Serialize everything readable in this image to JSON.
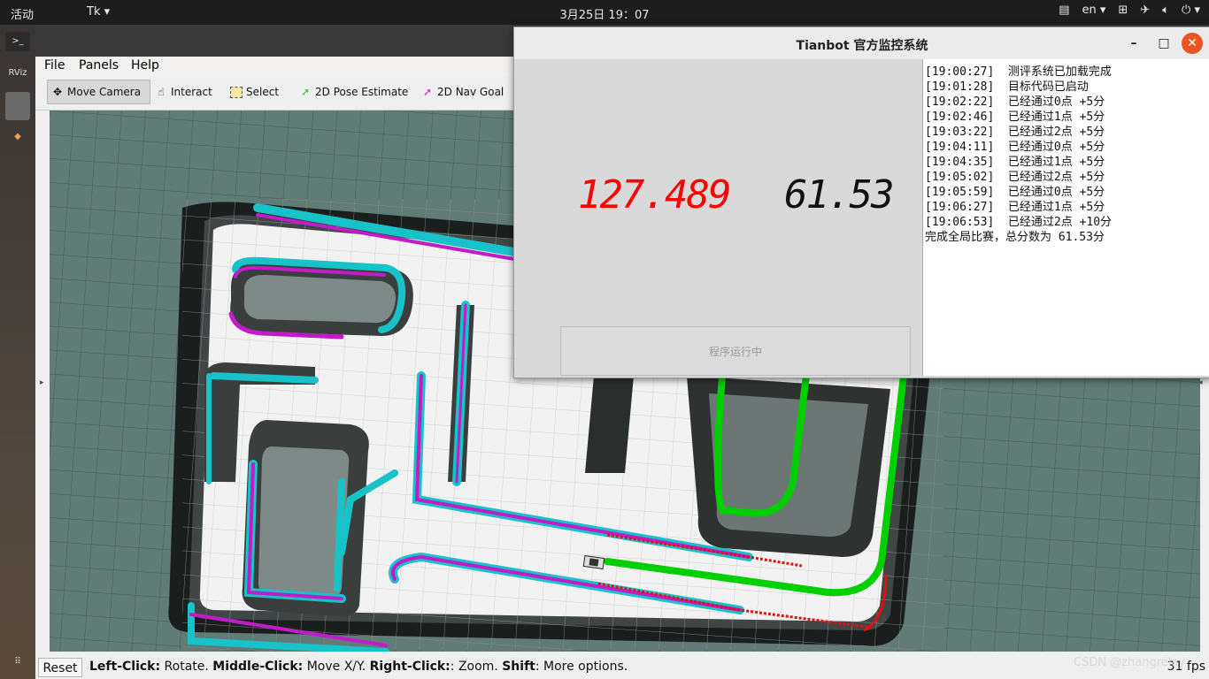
{
  "topbar": {
    "activities": "活动",
    "app_name": "Tk",
    "clock": "3月25日  19：07",
    "lang": "en"
  },
  "rviz": {
    "menu": [
      "File",
      "Panels",
      "Help"
    ],
    "tools": [
      {
        "label": "Move Camera",
        "icon": "move-camera-icon"
      },
      {
        "label": "Interact",
        "icon": "hand-icon"
      },
      {
        "label": "Select",
        "icon": "select-box-icon"
      },
      {
        "label": "2D Pose Estimate",
        "icon": "green-arrow-icon"
      },
      {
        "label": "2D Nav Goal",
        "icon": "magenta-arrow-icon"
      }
    ],
    "status": {
      "reset": "Reset",
      "help_parts": [
        {
          "bold": "Left-Click:",
          "text": " Rotate. "
        },
        {
          "bold": "Middle-Click:",
          "text": " Move X/Y. "
        },
        {
          "bold": "Right-Click:",
          "text": ": Zoom. "
        },
        {
          "bold": "Shift",
          "text": ": More options."
        }
      ],
      "fps": "31 fps"
    },
    "colors": {
      "grid_bg": "#617b77",
      "path_green": "#00d000",
      "cyan": "#17c3c8",
      "magenta": "#c21bc9"
    }
  },
  "monitor": {
    "title": "Tianbot 官方监控系统",
    "time_value": "127.489",
    "score_value": "61.53",
    "time_color": "#ff0000",
    "score_color": "#111111",
    "run_button": "程序运行中",
    "log": [
      "[19:00:27]  测评系统已加载完成",
      "[19:01:28]  目标代码已启动",
      "[19:02:22]  已经通过0点 +5分",
      "[19:02:46]  已经通过1点 +5分",
      "[19:03:22]  已经通过2点 +5分",
      "[19:04:11]  已经通过0点 +5分",
      "[19:04:35]  已经通过1点 +5分",
      "[19:05:02]  已经通过2点 +5分",
      "[19:05:59]  已经通过0点 +5分",
      "[19:06:27]  已经通过1点 +5分",
      "[19:06:53]  已经通过2点 +10分",
      "完成全局比赛，总分数为 61.53分"
    ]
  },
  "watermark": "CSDN @zhangrelay"
}
